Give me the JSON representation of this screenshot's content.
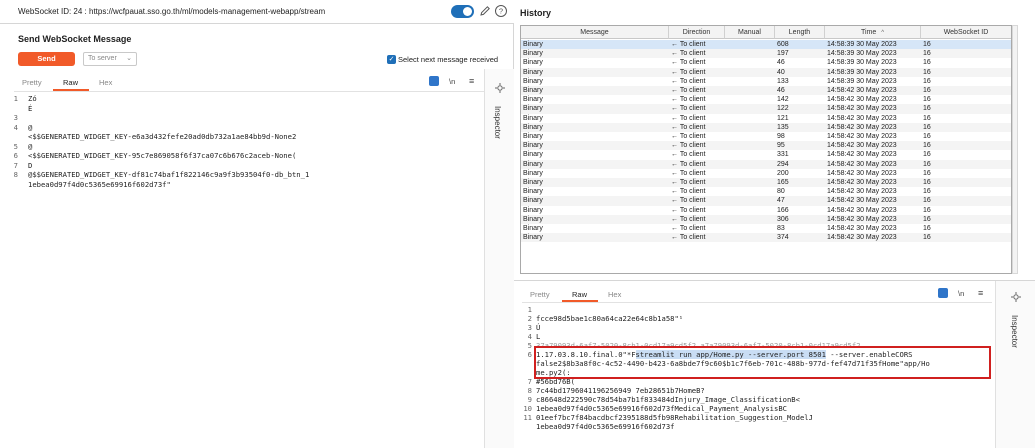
{
  "header": {
    "websocket_label": "WebSocket ID: 24 : https://wcfpauat.sso.go.th/ml/models-management-webapp/stream"
  },
  "send_panel": {
    "title": "Send WebSocket Message",
    "send_label": "Send",
    "direction_value": "To server",
    "select_next_label": "Select next message received",
    "select_next_checked": true,
    "tabs": [
      "Pretty",
      "Raw",
      "Hex"
    ],
    "active_tab": "Raw",
    "newline_label": "\\n",
    "menu_glyph": "≡",
    "lines": [
      {
        "n": "1",
        "text": "Zó"
      },
      {
        "n": "",
        "text": "É"
      },
      {
        "n": "3",
        "text": ""
      },
      {
        "n": "4",
        "text": "@"
      },
      {
        "n": "",
        "text": "<$$GENERATED_WIDGET_KEY-e6a3d432fefe20ad0db732a1ae84bb9d-None2"
      },
      {
        "n": "5",
        "text": "@"
      },
      {
        "n": "6",
        "text": "<$$GENERATED_WIDGET_KEY-95c7e869058f6f37ca07c6b676c2aceb-None("
      },
      {
        "n": "7",
        "text": "D"
      },
      {
        "n": "8",
        "text": "@$$GENERATED_WIDGET_KEY-df81c74baf1f822146c9a9f3b93504f0-db_btn_1"
      },
      {
        "n": "",
        "text": "1ebea0d97f4d0c5365e69916f602d73f\""
      }
    ],
    "inspector_label": "Inspector"
  },
  "history": {
    "title": "History",
    "columns": [
      "Message",
      "Direction",
      "Manual",
      "Length",
      "Time",
      "WebSocket ID"
    ],
    "sort_indicator": "^",
    "rows": [
      {
        "message": "Binary",
        "direction": "← To client",
        "manual": "",
        "length": "608",
        "time": "14:58:39 30 May 2023",
        "ws": "16"
      },
      {
        "message": "Binary",
        "direction": "← To client",
        "manual": "",
        "length": "197",
        "time": "14:58:39 30 May 2023",
        "ws": "16"
      },
      {
        "message": "Binary",
        "direction": "← To client",
        "manual": "",
        "length": "46",
        "time": "14:58:39 30 May 2023",
        "ws": "16"
      },
      {
        "message": "Binary",
        "direction": "← To client",
        "manual": "",
        "length": "40",
        "time": "14:58:39 30 May 2023",
        "ws": "16"
      },
      {
        "message": "Binary",
        "direction": "← To client",
        "manual": "",
        "length": "133",
        "time": "14:58:39 30 May 2023",
        "ws": "16"
      },
      {
        "message": "Binary",
        "direction": "← To client",
        "manual": "",
        "length": "46",
        "time": "14:58:42 30 May 2023",
        "ws": "16"
      },
      {
        "message": "Binary",
        "direction": "← To client",
        "manual": "",
        "length": "142",
        "time": "14:58:42 30 May 2023",
        "ws": "16"
      },
      {
        "message": "Binary",
        "direction": "← To client",
        "manual": "",
        "length": "122",
        "time": "14:58:42 30 May 2023",
        "ws": "16"
      },
      {
        "message": "Binary",
        "direction": "← To client",
        "manual": "",
        "length": "121",
        "time": "14:58:42 30 May 2023",
        "ws": "16"
      },
      {
        "message": "Binary",
        "direction": "← To client",
        "manual": "",
        "length": "135",
        "time": "14:58:42 30 May 2023",
        "ws": "16"
      },
      {
        "message": "Binary",
        "direction": "← To client",
        "manual": "",
        "length": "98",
        "time": "14:58:42 30 May 2023",
        "ws": "16"
      },
      {
        "message": "Binary",
        "direction": "← To client",
        "manual": "",
        "length": "95",
        "time": "14:58:42 30 May 2023",
        "ws": "16"
      },
      {
        "message": "Binary",
        "direction": "← To client",
        "manual": "",
        "length": "331",
        "time": "14:58:42 30 May 2023",
        "ws": "16"
      },
      {
        "message": "Binary",
        "direction": "← To client",
        "manual": "",
        "length": "294",
        "time": "14:58:42 30 May 2023",
        "ws": "16"
      },
      {
        "message": "Binary",
        "direction": "← To client",
        "manual": "",
        "length": "200",
        "time": "14:58:42 30 May 2023",
        "ws": "16"
      },
      {
        "message": "Binary",
        "direction": "← To client",
        "manual": "",
        "length": "165",
        "time": "14:58:42 30 May 2023",
        "ws": "16"
      },
      {
        "message": "Binary",
        "direction": "← To client",
        "manual": "",
        "length": "80",
        "time": "14:58:42 30 May 2023",
        "ws": "16"
      },
      {
        "message": "Binary",
        "direction": "← To client",
        "manual": "",
        "length": "47",
        "time": "14:58:42 30 May 2023",
        "ws": "16"
      },
      {
        "message": "Binary",
        "direction": "← To client",
        "manual": "",
        "length": "166",
        "time": "14:58:42 30 May 2023",
        "ws": "16"
      },
      {
        "message": "Binary",
        "direction": "← To client",
        "manual": "",
        "length": "306",
        "time": "14:58:42 30 May 2023",
        "ws": "16"
      },
      {
        "message": "Binary",
        "direction": "← To client",
        "manual": "",
        "length": "83",
        "time": "14:58:42 30 May 2023",
        "ws": "16"
      },
      {
        "message": "Binary",
        "direction": "← To client",
        "manual": "",
        "length": "374",
        "time": "14:58:42 30 May 2023",
        "ws": "16"
      }
    ]
  },
  "detail_panel": {
    "tabs": [
      "Pretty",
      "Raw",
      "Hex"
    ],
    "active_tab": "Raw",
    "newline_label": "\\n",
    "menu_glyph": "≡",
    "inspector_label": "Inspector",
    "lines": [
      {
        "n": "1",
        "text": ""
      },
      {
        "n": "2",
        "text": " fcce98d5bae1c80a64ca22e64c8b1a58\"¹"
      },
      {
        "n": "3",
        "text": "Ú"
      },
      {
        "n": "4",
        "text": "L"
      },
      {
        "n": "5",
        "text": "37a79093d-6af7-5020-8cb1-0cd17a9cd5f2 a7a79093d-6af7-5020-8cb1-0cd17a9cd5f2"
      },
      {
        "n": "6",
        "text_pre": "1.17.03.8.10.final.0\"*F",
        "text_sel": "streamlit run app/Home.py --server.port 8501",
        "text_post": " --server.enableCORS"
      },
      {
        "n": "",
        "text": "false2$8b3a8f0c-4c52-4490-b423-6a8bde7f9c60$b1c7f6eb-701c-488b-977d-fef47d71f35fHome\"app/Ho"
      },
      {
        "n": "",
        "text": "me.py2(:"
      },
      {
        "n": "7",
        "text": "#56bd76B("
      },
      {
        "n": "8",
        "text": " 7c44bd1796041196256949 7eb28651b7HomeB?"
      },
      {
        "n": "9",
        "text": " c86648d222590c78d54ba7b1f833484dInjury_Image_ClassificationB<"
      },
      {
        "n": "10",
        "text": " 1ebea0d97f4d0c5365e69916f602d73fMedical_Payment_AnalysisBC"
      },
      {
        "n": "11",
        "text": " 01eef7bc7f84bacdbcf2395188d5fb98Rehabilitation_Suggestion_ModelJ"
      },
      {
        "n": "",
        "text": " 1ebea0d97f4d0c5365e69916f602d73f"
      }
    ]
  },
  "colors": {
    "accent_orange": "#f15a29",
    "toggle_blue": "#1f6fb8",
    "selection_blue": "#d6e6f7",
    "highlight_red": "#d0201f"
  },
  "icons": [
    "pencil-icon",
    "help-icon",
    "settings-icon",
    "menu-icon"
  ]
}
